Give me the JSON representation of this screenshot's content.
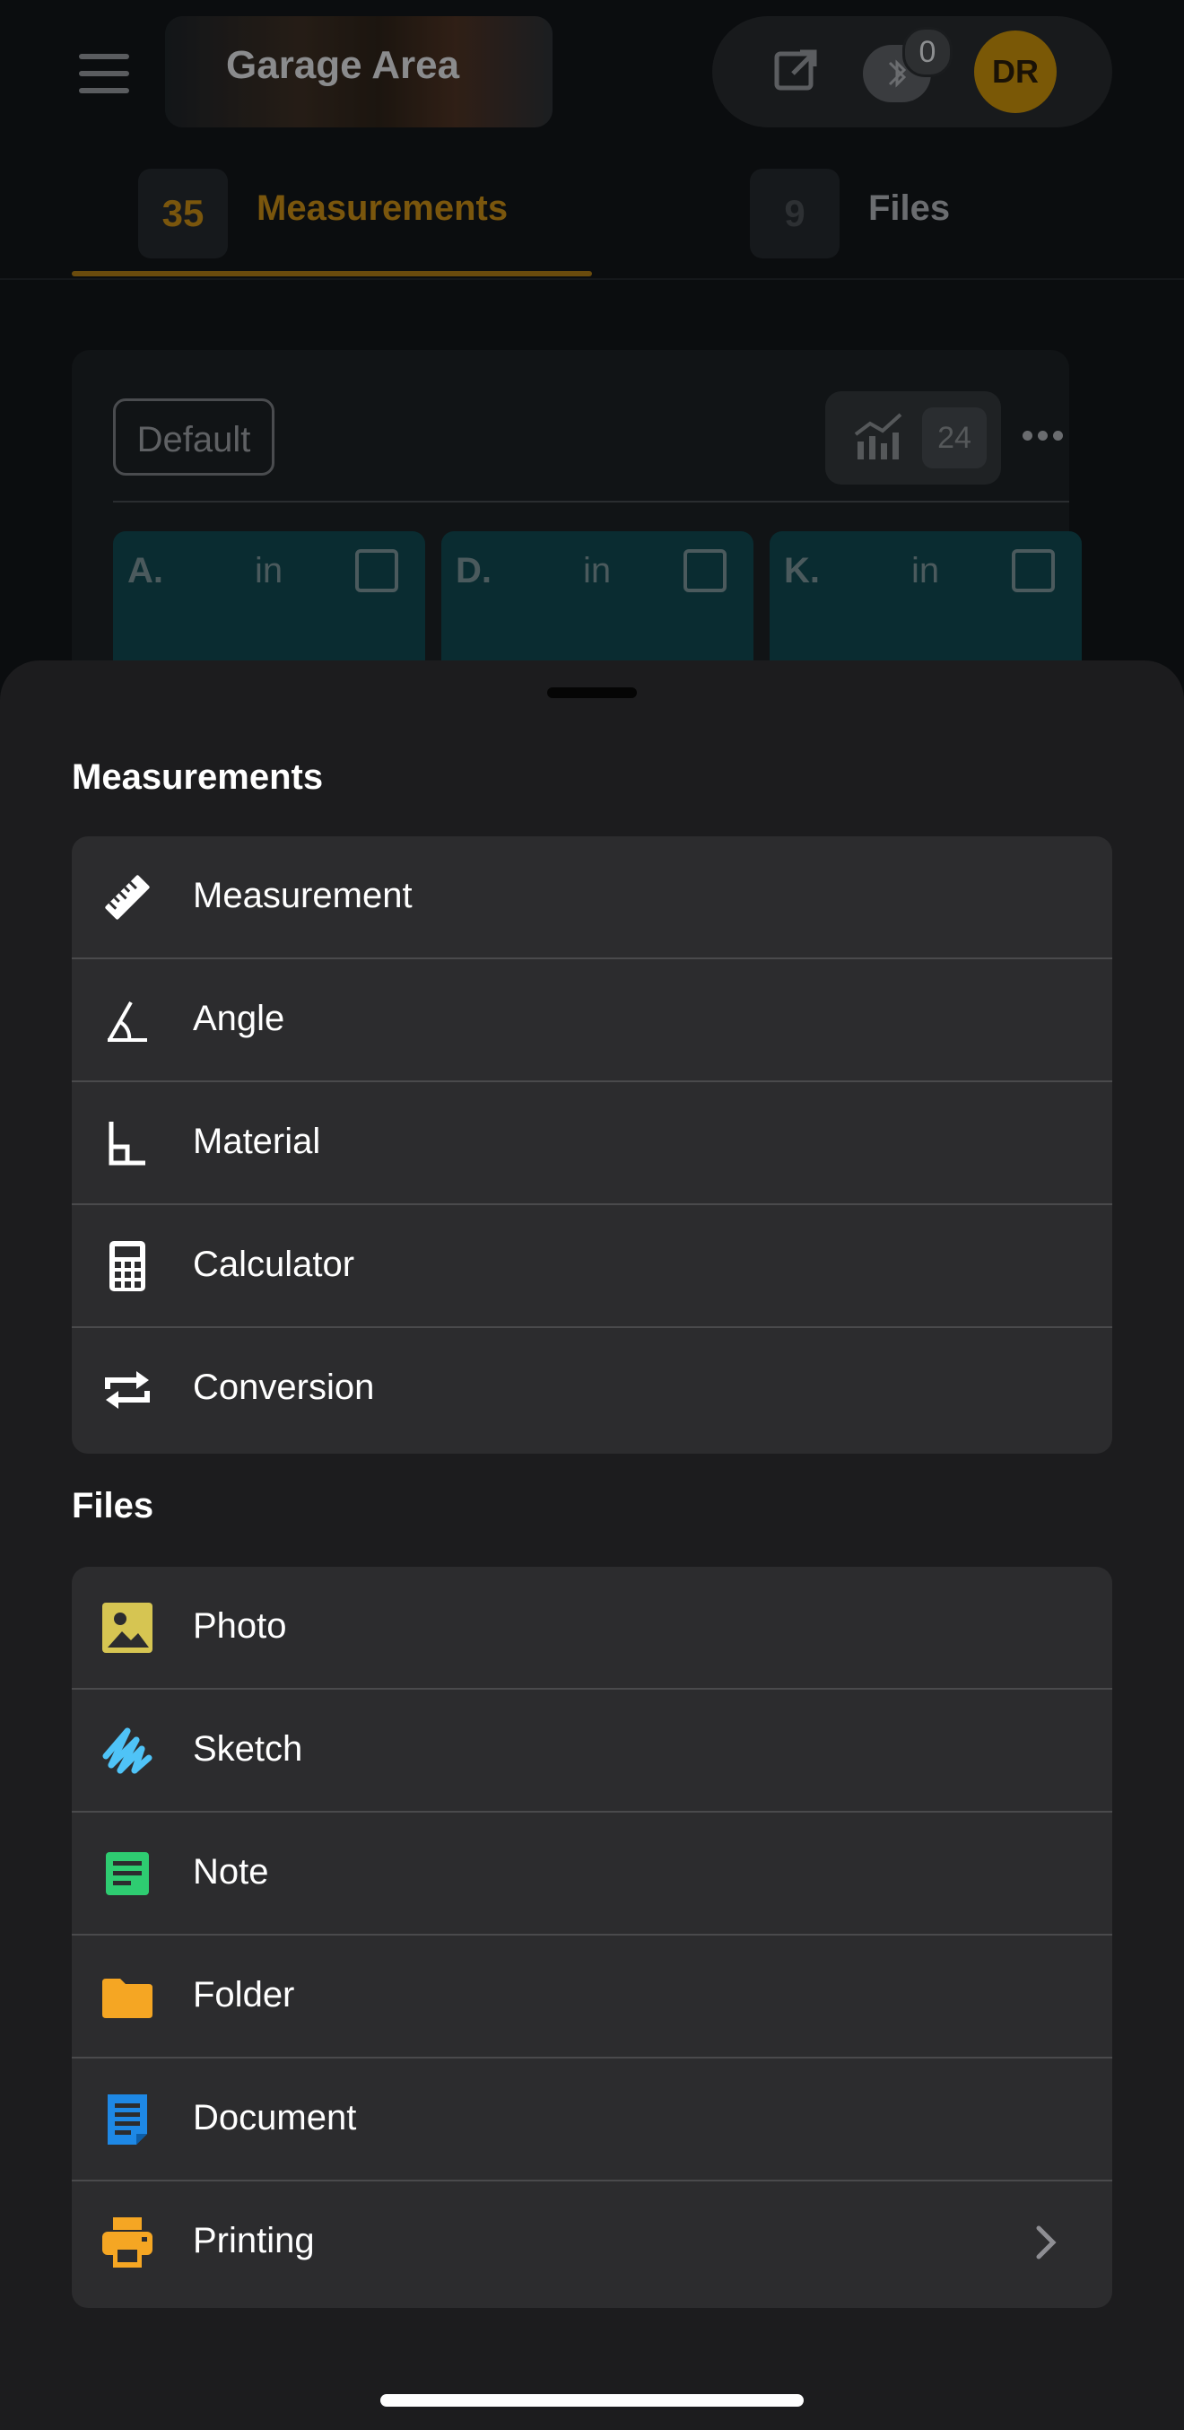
{
  "header": {
    "title": "Garage Area",
    "bluetooth_badge": "0",
    "avatar_initials": "DR"
  },
  "tabs": [
    {
      "count": "35",
      "label": "Measurements",
      "active": true,
      "color": "#7a560d"
    },
    {
      "count": "9",
      "label": "Files",
      "active": false,
      "color": "#6b6d70"
    }
  ],
  "panel": {
    "preset_label": "Default",
    "chart_count": "24",
    "cards": [
      {
        "letter": "A.",
        "unit": "in"
      },
      {
        "letter": "D.",
        "unit": "in"
      },
      {
        "letter": "K.",
        "unit": "in"
      }
    ]
  },
  "sheet": {
    "measurements_title": "Measurements",
    "measurement_items": [
      {
        "label": "Measurement",
        "icon": "ruler-icon"
      },
      {
        "label": "Angle",
        "icon": "angle-icon"
      },
      {
        "label": "Material",
        "icon": "material-corner-icon"
      },
      {
        "label": "Calculator",
        "icon": "calculator-icon"
      },
      {
        "label": "Conversion",
        "icon": "conversion-icon"
      }
    ],
    "files_title": "Files",
    "file_items": [
      {
        "label": "Photo",
        "icon": "photo-icon",
        "color": "#d6c552"
      },
      {
        "label": "Sketch",
        "icon": "sketch-icon",
        "color": "#4fc3f7"
      },
      {
        "label": "Note",
        "icon": "note-icon",
        "color": "#2ecc71"
      },
      {
        "label": "Folder",
        "icon": "folder-icon",
        "color": "#f5a623"
      },
      {
        "label": "Document",
        "icon": "document-icon",
        "color": "#1e88e5"
      },
      {
        "label": "Printing",
        "icon": "printer-icon",
        "color": "#f5a623"
      }
    ]
  }
}
